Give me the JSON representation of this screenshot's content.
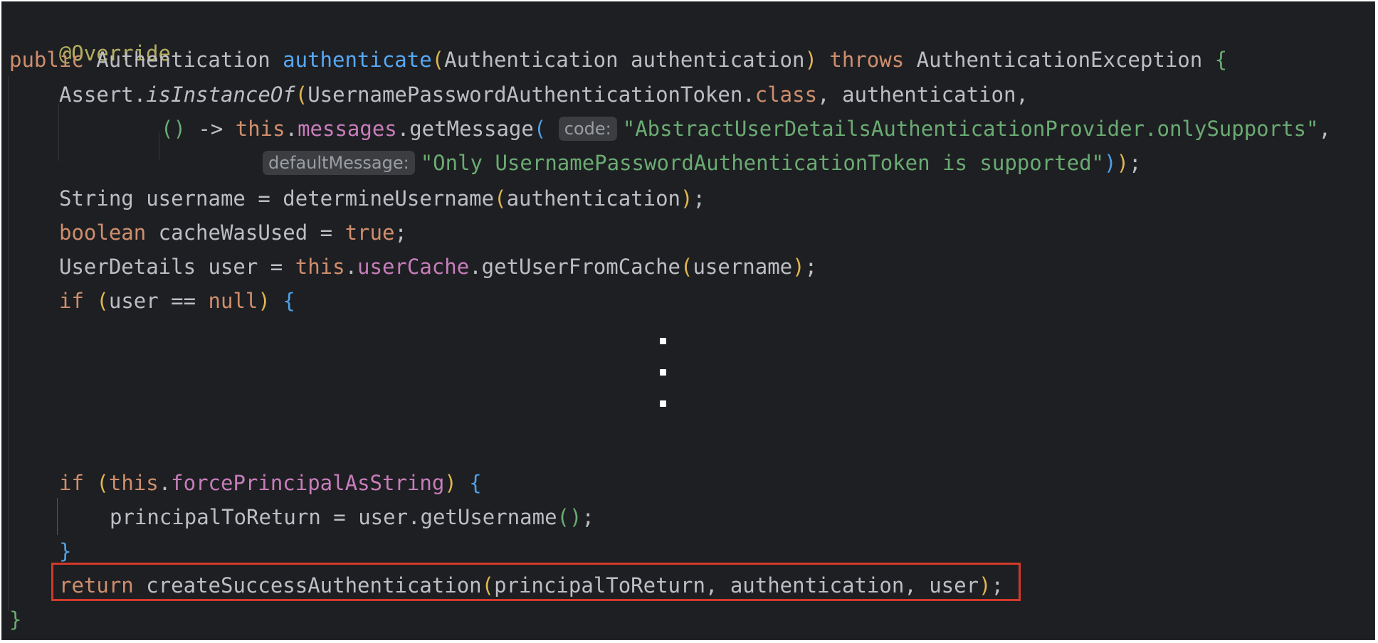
{
  "code": {
    "annotation": "@Override",
    "signature": {
      "kw_public": "public",
      "return_type": "Authentication",
      "method_name": "authenticate",
      "open_paren": "(",
      "param": "Authentication authentication",
      "close_paren": ")",
      "kw_throws": "throws",
      "exception": "AuthenticationException",
      "open_brace": "{"
    },
    "assert_line": {
      "prefix": "Assert.",
      "method": "isInstanceOf",
      "open_paren": "(",
      "type": "UsernamePasswordAuthenticationToken.",
      "kw_class": "class",
      "rest": ", authentication,"
    },
    "lambda_line": {
      "parens": "()",
      "arrow": " -> ",
      "kw_this": "this",
      "dot": ".",
      "field": "messages",
      "call": ".getMessage",
      "open_paren": "(",
      "hint": "code:",
      "string": "\"AbstractUserDetailsAuthenticationProvider.onlySupports\"",
      "comma": ","
    },
    "default_line": {
      "hint": "defaultMessage:",
      "string": "\"Only UsernamePasswordAuthenticationToken is supported\"",
      "close1": ")",
      "close2": ")",
      "semi": ";"
    },
    "username_line": {
      "text": "String username = determineUsername",
      "open_paren": "(",
      "arg": "authentication",
      "close_paren": ")",
      "semi": ";"
    },
    "cache_line": {
      "kw_boolean": "boolean",
      "text": " cacheWasUsed = ",
      "kw_true": "true",
      "semi": ";"
    },
    "user_line": {
      "text": "UserDetails user = ",
      "kw_this": "this",
      "dot": ".",
      "field": "userCache",
      "call": ".getUserFromCache",
      "open_paren": "(",
      "arg": "username",
      "close_paren": ")",
      "semi": ";"
    },
    "if_null_line": {
      "kw_if": "if",
      "open_paren": "(",
      "text": "user == ",
      "kw_null": "null",
      "close_paren": ")",
      "open_brace": "{"
    },
    "if_force_line": {
      "kw_if": "if",
      "open_paren": "(",
      "kw_this": "this",
      "dot": ".",
      "field": "forcePrincipalAsString",
      "close_paren": ")",
      "open_brace": "{"
    },
    "principal_line": {
      "text": "principalToReturn = user.getUsername",
      "parens": "()",
      "semi": ";"
    },
    "close_if_brace": "}",
    "return_line": {
      "kw_return": "return",
      "text": " createSuccessAuthentication",
      "open_paren": "(",
      "args": "principalToReturn, authentication, user",
      "close_paren": ")",
      "semi": ";"
    },
    "close_method_brace": "}"
  },
  "colors": {
    "background": "#1e1f22",
    "keyword": "#cf8e6d",
    "method": "#56a8f5",
    "field": "#c77dbb",
    "string": "#6aab73",
    "annotation": "#b3ae60",
    "highlight_border": "#d23a2a"
  }
}
